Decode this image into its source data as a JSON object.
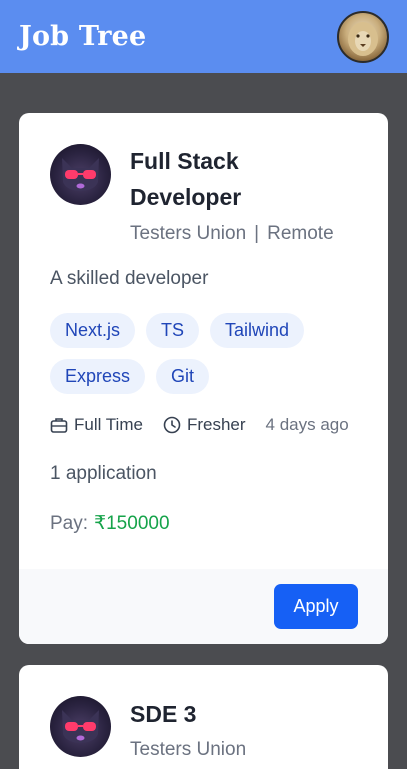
{
  "app": {
    "title": "Job Tree"
  },
  "jobs": [
    {
      "title": "Full Stack Developer",
      "company": "Testers Union",
      "separator": "|",
      "location": "Remote",
      "description": "A skilled developer",
      "tags": [
        "Next.js",
        "TS",
        "Tailwind",
        "Express",
        "Git"
      ],
      "job_type": "Full Time",
      "experience": "Fresher",
      "posted": "4 days ago",
      "applications": "1 application",
      "pay_label": "Pay:",
      "pay_value": "₹150000",
      "apply_label": "Apply"
    },
    {
      "title": "SDE 3",
      "company": "Testers Union"
    }
  ],
  "colors": {
    "header": "#5b8df0",
    "accent": "#1660f5",
    "pay": "#16a34a",
    "tag_bg": "#ecf2fd"
  },
  "icons": {
    "job_type": "briefcase-icon",
    "experience": "clock-icon"
  }
}
